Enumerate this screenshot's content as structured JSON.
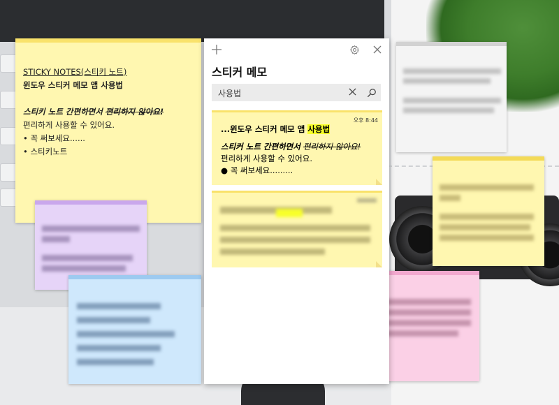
{
  "panel": {
    "title": "스티커 메모",
    "icons": {
      "add": "plus-icon",
      "settings": "gear-icon",
      "close": "close-icon"
    },
    "search": {
      "value": "사용법",
      "clear_icon": "clear-icon",
      "search_icon": "search-icon"
    },
    "cards": [
      {
        "time": "오후 8:44",
        "title_prefix": "...윈도우 스티커 메모 앱 ",
        "title_highlight": "사용법",
        "line2_bold_italic": "스티커 노트 간편하면서 ",
        "line2_strike": "편리하지 않아요!",
        "line3": "편리하게 사용할 수 있어요.",
        "line4": "● 꼭 써보세요........."
      }
    ]
  },
  "main_note": {
    "header_link": "STICKY NOTES(스티키 노트)",
    "title": "윈도우 스티커 메모 앱 사용법",
    "line_bold_italic": "스티키 노트 간편하면서 ",
    "line_strike": "편리하지 않아요!",
    "line3": "편리하게 사용할 수 있어요.",
    "bullet1": "• 꼭 써보세요......",
    "bullet2": "• 스티키노트"
  },
  "colors": {
    "yellow_note": "#fff7b0",
    "yellow_bar": "#f9e26b",
    "purple_note": "#e6d4f8",
    "blue_note": "#cfe8fc",
    "pink_note": "#fbd0e6",
    "gray_note": "#f4f4f4",
    "highlight": "#f8ff2a"
  }
}
